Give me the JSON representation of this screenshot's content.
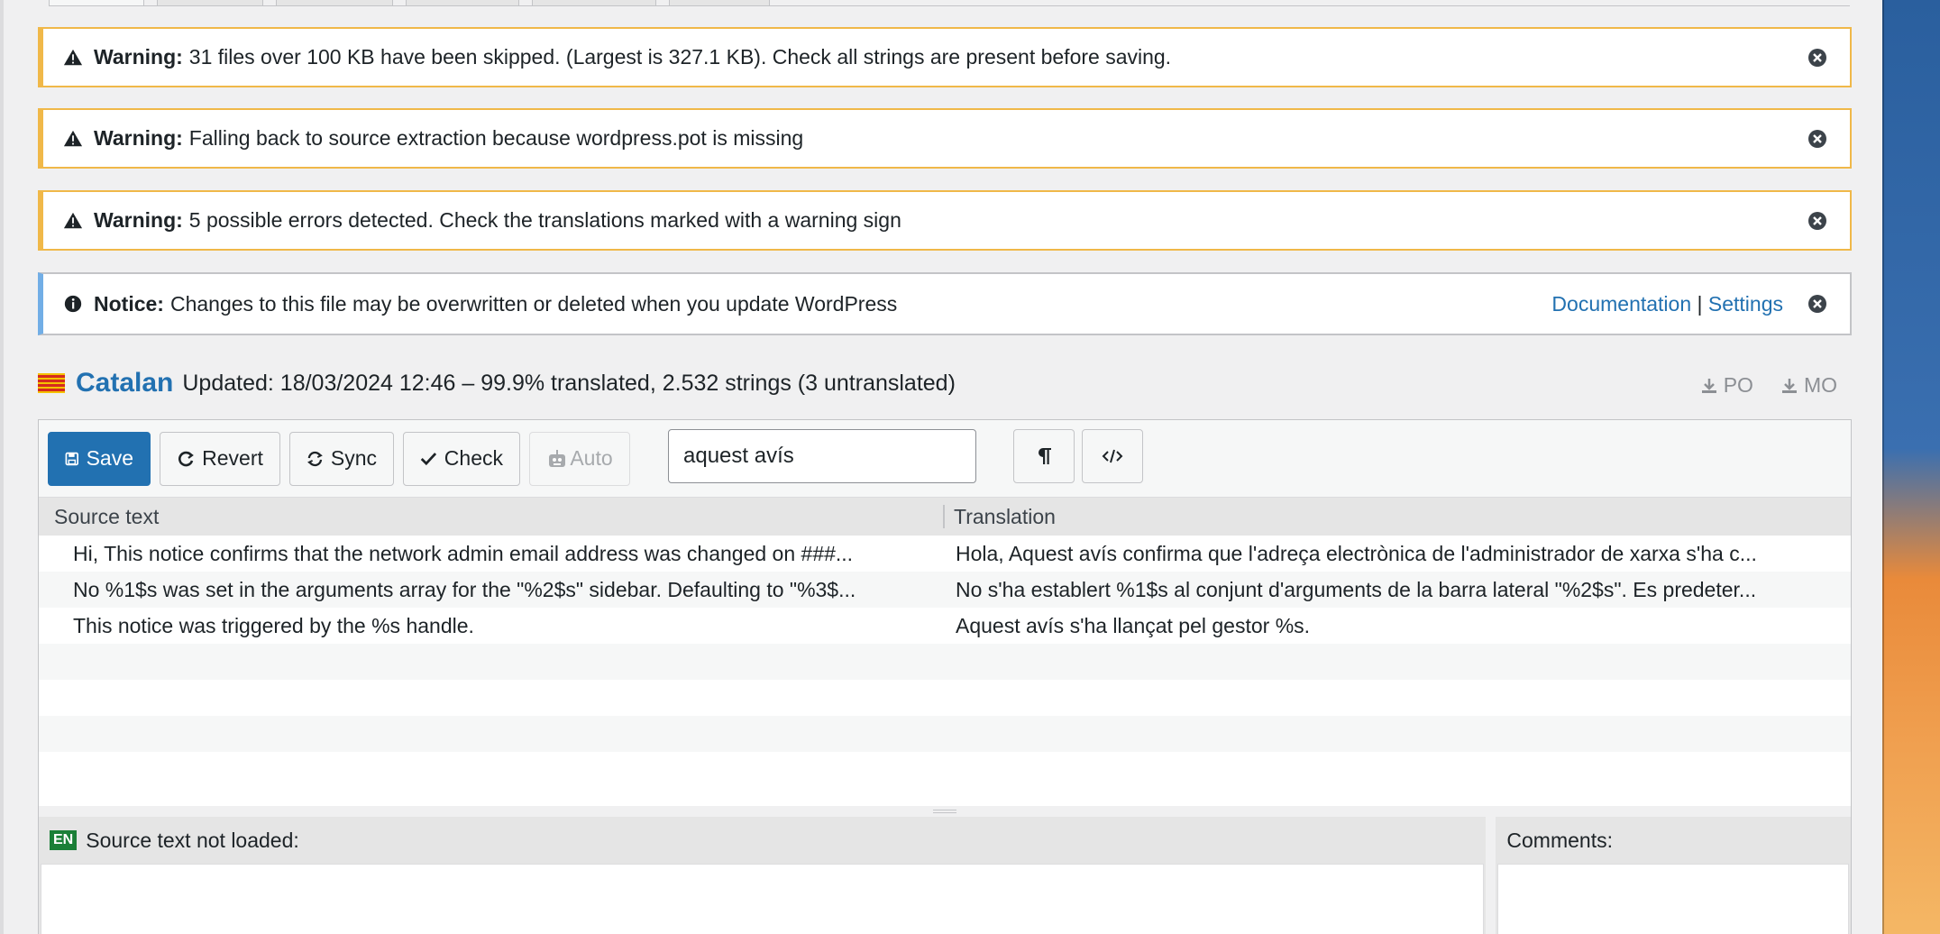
{
  "notices": [
    {
      "type": "warning",
      "label": "Warning:",
      "message": "31 files over 100 KB have been skipped. (Largest is 327.1 KB). Check all strings are present before saving."
    },
    {
      "type": "warning",
      "label": "Warning:",
      "message": "Falling back to source extraction because wordpress.pot is missing"
    },
    {
      "type": "warning",
      "label": "Warning:",
      "message": "5 possible errors detected. Check the translations marked with a warning sign"
    },
    {
      "type": "info",
      "label": "Notice:",
      "message": "Changes to this file may be overwritten or deleted when you update WordPress",
      "link_docs": "Documentation",
      "separator": "|",
      "link_settings": "Settings"
    }
  ],
  "language": {
    "name": "Catalan",
    "meta": "Updated: 18/03/2024 12:46 – 99.9% translated, 2.532 strings (3 untranslated)"
  },
  "downloads": {
    "po": "PO",
    "mo": "MO"
  },
  "toolbar": {
    "save": "Save",
    "revert": "Revert",
    "sync": "Sync",
    "check": "Check",
    "auto": "Auto",
    "search_value": "aquest avís"
  },
  "table": {
    "headers": {
      "source": "Source text",
      "translation": "Translation"
    },
    "rows": [
      {
        "source": "Hi, This notice confirms that the network admin email address was changed on ###...",
        "translation": "Hola, Aquest avís confirma que l'adreça electrònica de l'administrador de xarxa s'ha c..."
      },
      {
        "source": "No %1$s was set in the arguments array for the \"%2$s\" sidebar. Defaulting to \"%3$...",
        "translation": "No s'ha establert %1$s al conjunt d'arguments de la barra lateral \"%2$s\". Es predeter..."
      },
      {
        "source": "This notice was triggered by the %s handle.",
        "translation": "Aquest avís s'ha llançat pel gestor %s."
      }
    ]
  },
  "source_pane": {
    "badge": "EN",
    "title": "Source text not loaded:"
  },
  "comments_pane": {
    "title": "Comments:"
  },
  "colors": {
    "warning": "#f0b849",
    "info": "#72aee6",
    "primary": "#2271b1"
  }
}
